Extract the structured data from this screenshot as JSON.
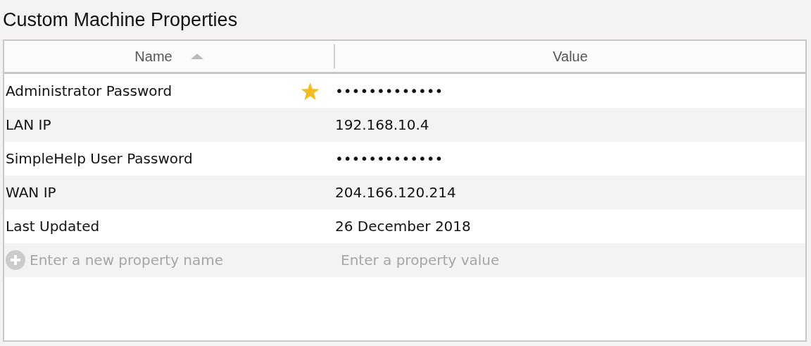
{
  "title": "Custom Machine Properties",
  "table": {
    "columns": [
      {
        "label": "Name",
        "sorted": true
      },
      {
        "label": "Value",
        "sorted": false
      }
    ],
    "rows": [
      {
        "name": "Administrator Password",
        "value": "•••••••••••••",
        "starred": true
      },
      {
        "name": "LAN IP",
        "value": "192.168.10.4",
        "starred": false
      },
      {
        "name": "SimpleHelp User Password",
        "value": "•••••••••••••",
        "starred": false
      },
      {
        "name": "WAN IP",
        "value": "204.166.120.214",
        "starred": false
      },
      {
        "name": "Last Updated",
        "value": "26 December 2018",
        "starred": false
      }
    ],
    "new_row": {
      "name_placeholder": "Enter a new property name",
      "value_placeholder": "Enter a property value"
    }
  }
}
